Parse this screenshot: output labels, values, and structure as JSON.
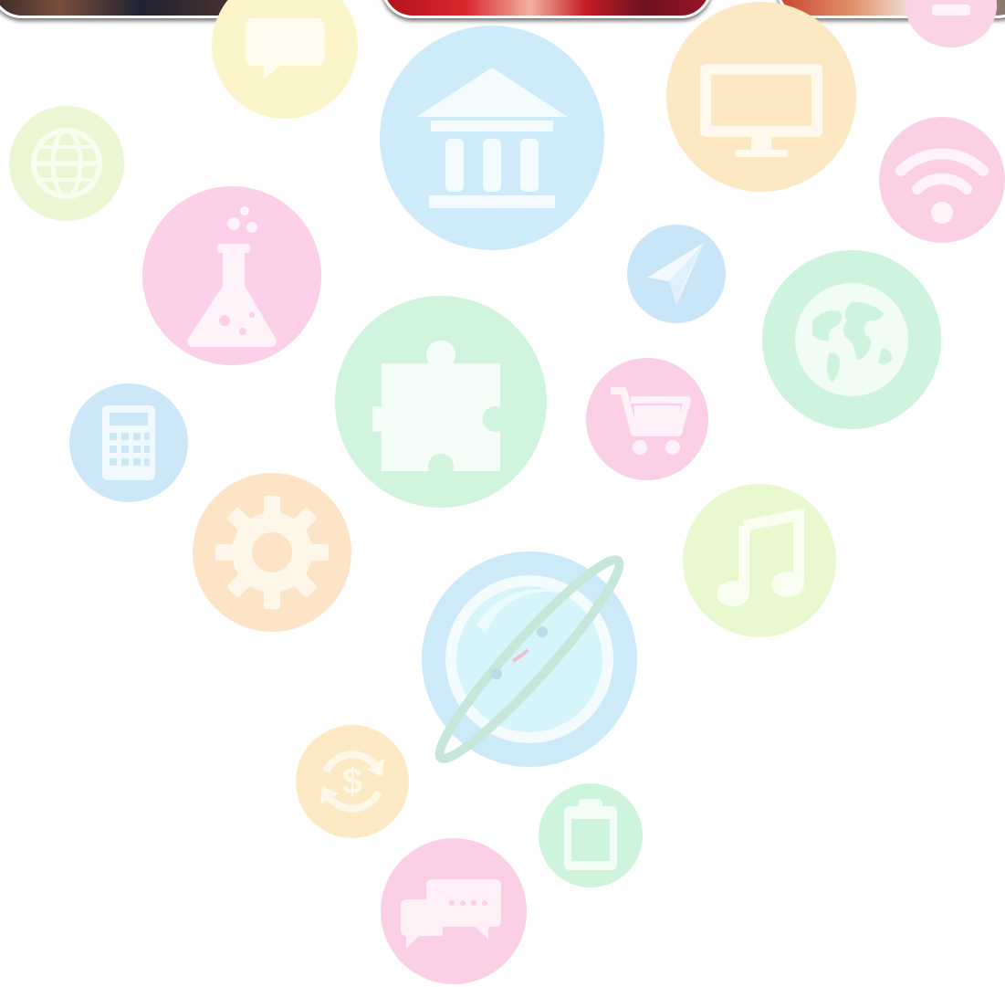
{
  "page": {
    "background": "#ffffff"
  },
  "cards": [
    {
      "name": "card-left",
      "theme": "dark-photo"
    },
    {
      "name": "card-middle",
      "theme": "red-photo"
    },
    {
      "name": "card-right",
      "theme": "warm-photo"
    }
  ],
  "palette": {
    "yellow": "#fbf3c8",
    "blue": "#cdebf9",
    "peach": "#fde7c3",
    "lime": "#e7f6cd",
    "pink": "#fbd0e6",
    "mint": "#cff3dc",
    "orange": "#fde4c6",
    "sky": "#c8e6f7"
  },
  "decorative_icons": [
    "chat-bubble-icon",
    "bank-building-icon",
    "monitor-icon",
    "globe-grid-icon",
    "flask-icon",
    "wifi-icon",
    "paper-plane-icon",
    "world-map-icon",
    "puzzle-piece-icon",
    "calculator-icon",
    "shopping-cart-icon",
    "gear-icon",
    "music-note-icon",
    "planet-ring-icon",
    "currency-refresh-icon",
    "clipboard-icon",
    "messages-icon",
    "partial-pink-icon"
  ]
}
